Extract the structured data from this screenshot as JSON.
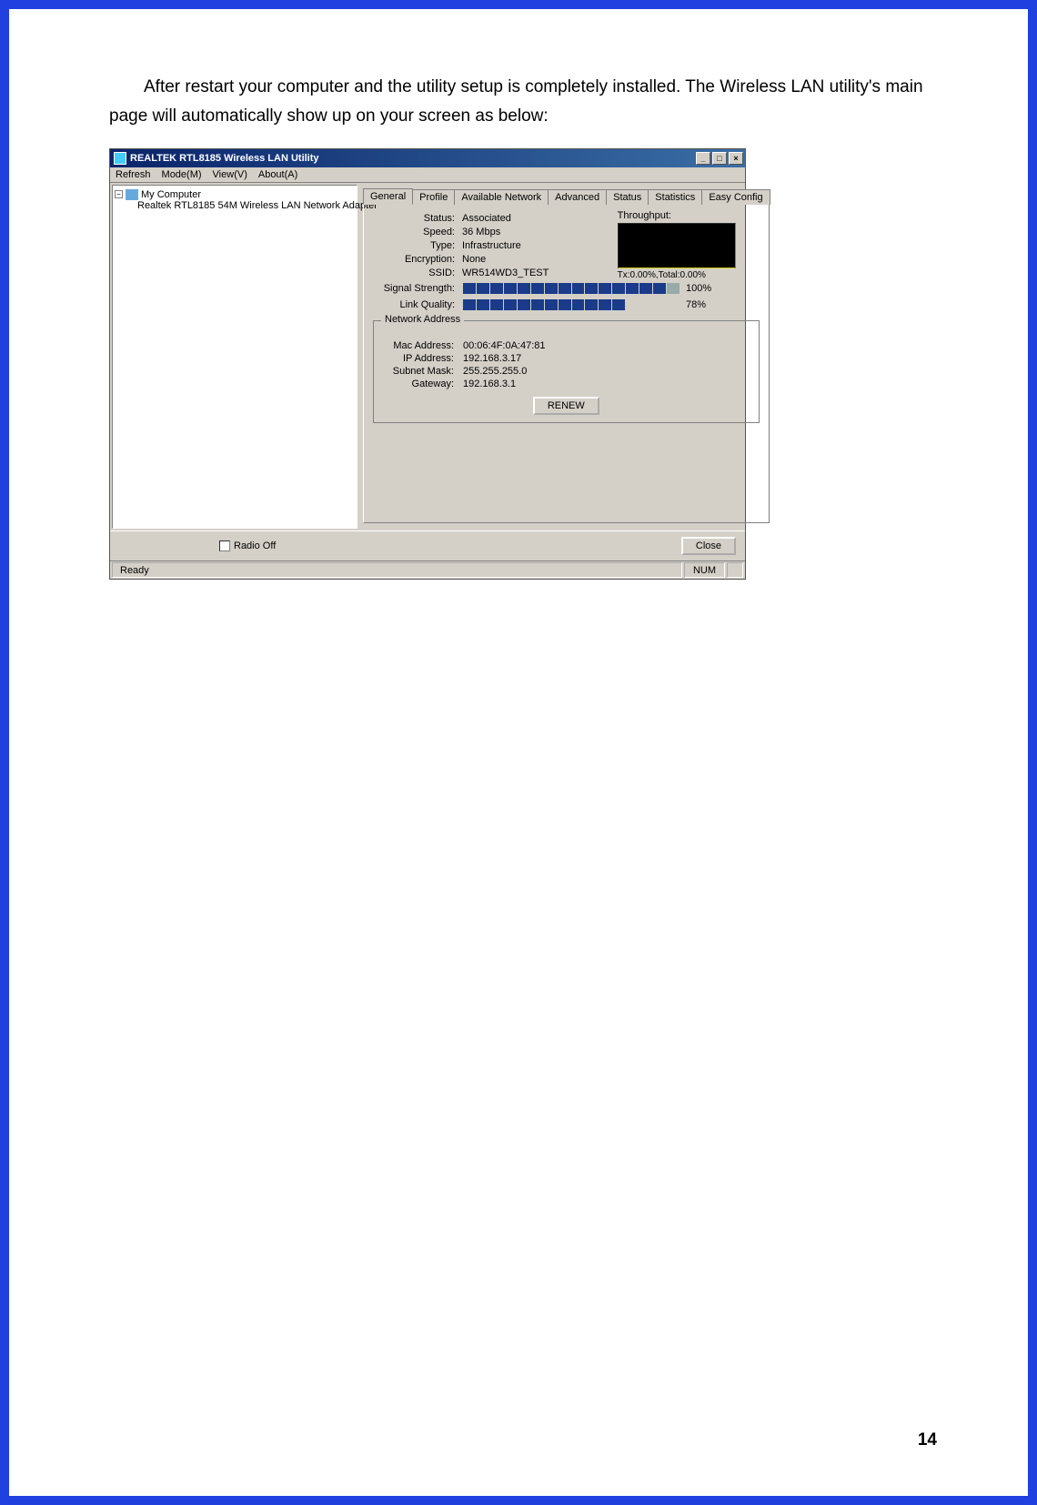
{
  "doc": {
    "paragraph": "After restart your computer and the utility setup is completely installed. The Wireless LAN utility's main page will automatically show up on your screen as below:",
    "page_number": "14"
  },
  "window": {
    "title": "REALTEK RTL8185 Wireless LAN Utility",
    "controls": {
      "min": "_",
      "max": "□",
      "close": "×"
    },
    "menu": {
      "refresh": "Refresh",
      "mode": "Mode(M)",
      "view": "View(V)",
      "about": "About(A)"
    },
    "tree": {
      "root": "My Computer",
      "adapter": "Realtek RTL8185 54M Wireless LAN Network Adapter"
    },
    "tabs": {
      "general": "General",
      "profile": "Profile",
      "available": "Available Network",
      "advanced": "Advanced",
      "status": "Status",
      "statistics": "Statistics",
      "easy": "Easy Config"
    },
    "general": {
      "status_label": "Status:",
      "status_value": "Associated",
      "speed_label": "Speed:",
      "speed_value": "36 Mbps",
      "type_label": "Type:",
      "type_value": "Infrastructure",
      "encryption_label": "Encryption:",
      "encryption_value": "None",
      "ssid_label": "SSID:",
      "ssid_value": "WR514WD3_TEST",
      "signal_label": "Signal Strength:",
      "signal_pct": "100%",
      "quality_label": "Link Quality:",
      "quality_pct": "78%"
    },
    "throughput": {
      "label": "Throughput:",
      "stats": "Tx:0.00%,Total:0.00%"
    },
    "network_address": {
      "legend": "Network Address",
      "mac_label": "Mac Address:",
      "mac_value": "00:06:4F:0A:47:81",
      "ip_label": "IP Address:",
      "ip_value": "192.168.3.17",
      "subnet_label": "Subnet Mask:",
      "subnet_value": "255.255.255.0",
      "gateway_label": "Gateway:",
      "gateway_value": "192.168.3.1",
      "renew": "RENEW"
    },
    "bottom": {
      "radio_off": "Radio Off",
      "close": "Close"
    },
    "statusbar": {
      "ready": "Ready",
      "num": "NUM"
    }
  }
}
